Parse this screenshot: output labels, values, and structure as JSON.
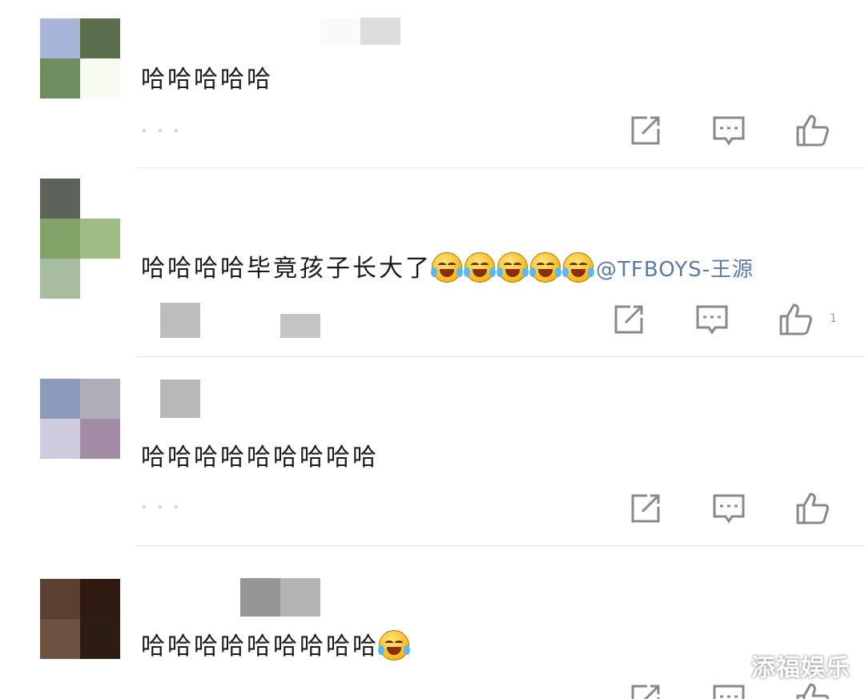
{
  "comments": [
    {
      "text": "哈哈哈哈哈",
      "avatar_colors": [
        "#a8b4d8",
        "#5a6e4c",
        "#6e8e60",
        "#f7fbf2"
      ],
      "name_blur_colors": [
        "#ffffff",
        "#ffffff",
        "#fafafa",
        "#dcdcdc"
      ]
    },
    {
      "text": "哈哈哈哈毕竟孩子长大了",
      "mention": "@TFBOYS-王源",
      "emojis": [
        "cry-laugh-emoji",
        "cry-laugh-emoji",
        "laugh-tears-emoji",
        "laugh-tears-emoji",
        "laugh-tears-emoji"
      ],
      "avatar_colors": [
        "#5c625c",
        "#ffffff",
        "#80a468",
        "#9dbc86",
        "#a8bca0",
        "#ffffff"
      ],
      "name_blur_colors": [
        "#bdbdbd",
        "#ffffff",
        "#ffffff",
        "#c4c4c4"
      ],
      "like_count": "1"
    },
    {
      "text": "哈哈哈哈哈哈哈哈哈",
      "avatar_colors": [
        "#8c9bbc",
        "#b0aeb6",
        "#d0cce0",
        "#a28ca6"
      ],
      "name_blur_colors": [
        "#ffffff",
        "#b8b8b8"
      ]
    },
    {
      "text": "哈哈哈哈哈哈哈哈哈",
      "emojis": [
        "cry-laugh-emoji"
      ],
      "avatar_colors": [
        "#5a4030",
        "#2e1a10",
        "#6e5240",
        "#2c1c12"
      ],
      "name_blur_colors": [
        "#ffffff",
        "#ffffff",
        "#969696",
        "#b4b4b4"
      ]
    }
  ],
  "actions": {
    "share_icon": "share-external-icon",
    "reply_icon": "comment-icon",
    "like_icon": "thumbs-up-icon"
  },
  "watermark": "添福娱乐",
  "colors": {
    "icon": "#888888",
    "mention": "#5b7ba3",
    "divider": "#e6e6e6"
  }
}
